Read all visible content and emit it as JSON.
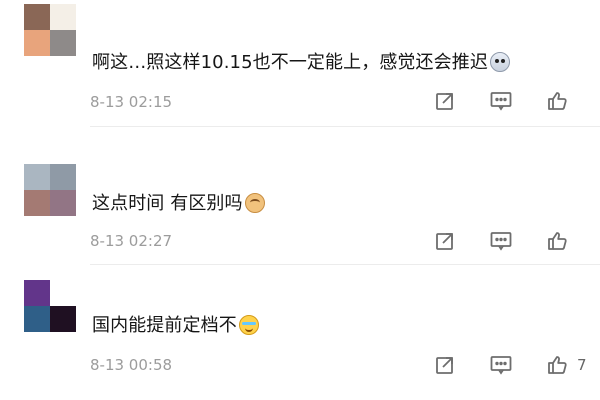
{
  "comments": [
    {
      "text": "啊这…照这样10.15也不一定能上，感觉还会推迟",
      "emoji_name": "husky-emoji",
      "timestamp": "8-13 02:15",
      "actions": {
        "share_icon": "share-icon",
        "comment_icon": "comment-icon",
        "like_icon": "like-icon",
        "like_count": ""
      },
      "avatar_colors": [
        "#8a6756",
        "#f4efe7",
        "#e8a47c",
        "#8e8a89"
      ]
    },
    {
      "text": "这点时间 有区别吗",
      "emoji_name": "cat-emoji",
      "timestamp": "8-13 02:27",
      "actions": {
        "share_icon": "share-icon",
        "comment_icon": "comment-icon",
        "like_icon": "like-icon",
        "like_count": ""
      },
      "avatar_colors": [
        "#aab6c1",
        "#8f9aa6",
        "#a47a73",
        "#927585"
      ]
    },
    {
      "text": "国内能提前定档不",
      "emoji_name": "laugh-cry-emoji",
      "timestamp": "8-13 00:58",
      "actions": {
        "share_icon": "share-icon",
        "comment_icon": "comment-icon",
        "like_icon": "like-icon",
        "like_count": "7"
      },
      "avatar_colors": [
        "#62358a",
        "#5a416a",
        "#2f5f88",
        "#1f1022",
        "#e6e6ec",
        "#ffffff"
      ]
    }
  ],
  "colors": {
    "background": "#ffffff",
    "body_text": "#161616",
    "meta_text": "#9c9c9c",
    "icon": "#6d6d6d",
    "divider": "#ececec"
  }
}
